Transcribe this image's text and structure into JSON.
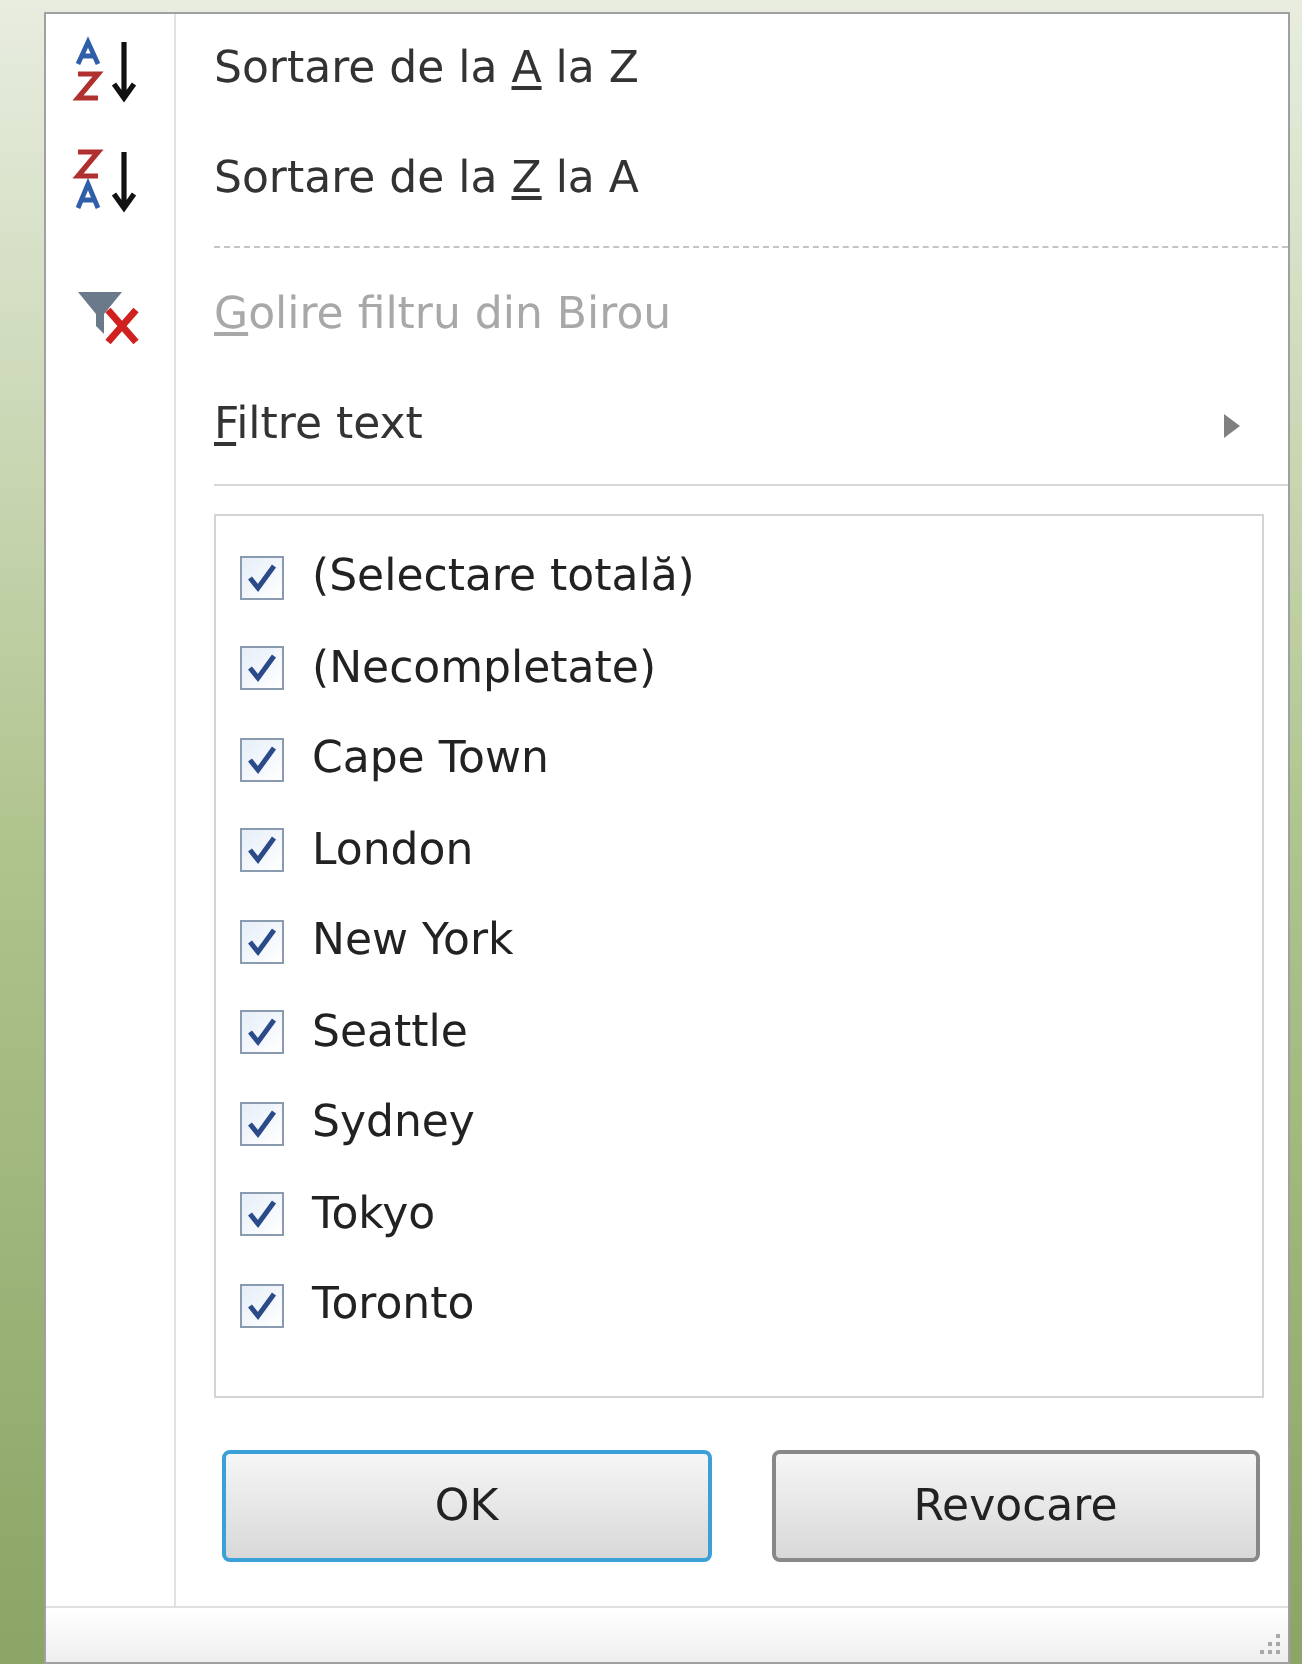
{
  "menu_items": [
    {
      "kind": "sort-asc",
      "before": "Sortare de la ",
      "key": "A",
      "after": " la Z",
      "disabled": false,
      "submenu": false
    },
    {
      "kind": "sort-desc",
      "before": "Sortare de la ",
      "key": "Z",
      "after": " la A",
      "disabled": false,
      "submenu": false
    },
    {
      "kind": "separator"
    },
    {
      "kind": "clear-filter",
      "key": "G",
      "after": "olire filtru din Birou",
      "disabled": true,
      "submenu": false
    },
    {
      "kind": "plain",
      "key": "F",
      "after": "iltre text",
      "disabled": false,
      "submenu": true
    }
  ],
  "values": [
    {
      "label": "(Selectare totală)",
      "checked": true
    },
    {
      "label": "(Necompletate)",
      "checked": true
    },
    {
      "label": "Cape Town",
      "checked": true
    },
    {
      "label": "London",
      "checked": true
    },
    {
      "label": "New York",
      "checked": true
    },
    {
      "label": "Seattle",
      "checked": true
    },
    {
      "label": "Sydney",
      "checked": true
    },
    {
      "label": "Tokyo",
      "checked": true
    },
    {
      "label": "Toronto",
      "checked": true
    }
  ],
  "buttons": [
    {
      "label": "OK",
      "default": true
    },
    {
      "label": "Revocare",
      "default": false
    }
  ]
}
